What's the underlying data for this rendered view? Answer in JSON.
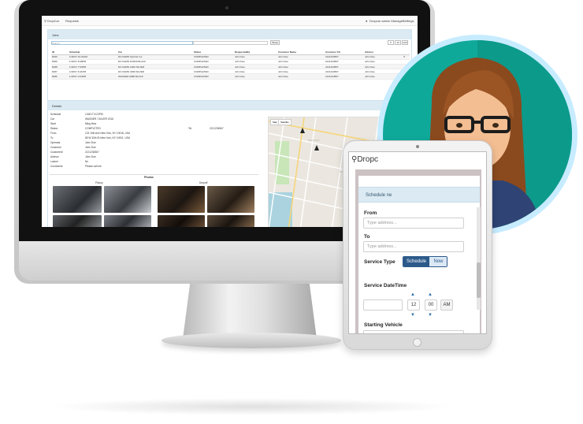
{
  "app": {
    "logo": "DropCar",
    "nav_item": "Requests",
    "user_label": "Dropcar admin Manager",
    "settings_label": "Settings"
  },
  "jobs": {
    "title": "Jobs",
    "search_placeholder": "Search",
    "show_label": "Show",
    "pagination": [
      "5",
      "10",
      "100"
    ],
    "columns": [
      "ID",
      "Schedule",
      "Car",
      "Status",
      "RequestedBy",
      "Customer Name",
      "Customer Tel",
      "Advisor"
    ],
    "rows": [
      [
        "8190",
        "1/18/17 10:22AM",
        "DO DAMN Sprinter Ins",
        "COMPLETED",
        "John Doe",
        "John Doe",
        "2121234567",
        "John Doe"
      ],
      [
        "8189",
        "1/18/17 8:48PM",
        "DO DAMN DO830 BLACK",
        "COMPLETED",
        "John Doe",
        "John Doe",
        "2121234567",
        "John Doe"
      ],
      [
        "8188",
        "1/18/17 7:53PM",
        "DO DAMN A400 SILVER",
        "COMPLETED",
        "John Doe",
        "John Doe",
        "2121234567",
        "John Doe"
      ],
      [
        "8187",
        "1/18/17 6:41PM",
        "DO DAMN 3280 SILVER",
        "COMPLETED",
        "John Doe",
        "John Doe",
        "2121234567",
        "John Doe"
      ],
      [
        "8186",
        "1/18/17 4:04PM",
        "WAGNER A880 BLACK",
        "COMPLETED",
        "John Doe",
        "John Doe",
        "2121234567",
        "John Doe"
      ]
    ]
  },
  "details": {
    "title": "Details",
    "fields": [
      {
        "label": "Schedule",
        "value": "1/18/17 5:22PM"
      },
      {
        "label": "Car",
        "value": "WAGNER / SILVER 2016"
      },
      {
        "label": "Start",
        "value": "Ming New"
      },
      {
        "label": "Status",
        "value": "COMPLETED"
      },
      {
        "label": "From",
        "value": "123 10th Ave New York, NY 10018, USA"
      },
      {
        "label": "To",
        "value": "85 W 30th St New York, NY 10001, USA"
      },
      {
        "label": "Operator",
        "value": "John Doe"
      },
      {
        "label": "Customer",
        "value": "John Doe"
      },
      {
        "label": "Customer#",
        "value": "2121234567"
      },
      {
        "label": "Advisor",
        "value": "John Doe"
      },
      {
        "label": "Loaner",
        "value": "No"
      },
      {
        "label": "Comments",
        "value": "Please call me"
      }
    ],
    "tel_label": "Tel.",
    "tel_value": "2121234567",
    "photos_title": "Photos",
    "pickup_label": "Pickup",
    "dropoff_label": "Dropoff",
    "map_tabs": [
      "Map",
      "Satellite"
    ]
  },
  "mobile": {
    "logo": "Dropc",
    "form_title": "Schedule ne",
    "from_label": "From",
    "from_placeholder": "Type address...",
    "to_label": "To",
    "to_placeholder": "Type address...",
    "service_type_label": "Service Type",
    "schedule_option": "Schedule",
    "now_option": "Now",
    "datetime_label": "Service DateTime",
    "hour": "12",
    "minute": "00",
    "ampm": "AM",
    "vehicle_label": "Starting Vehicle"
  },
  "colors": {
    "panel_header": "#dbeaf3",
    "segment_active": "#2c5a8a",
    "avatar_bg": "#0fa99a",
    "avatar_ring": "#c7ecff"
  }
}
